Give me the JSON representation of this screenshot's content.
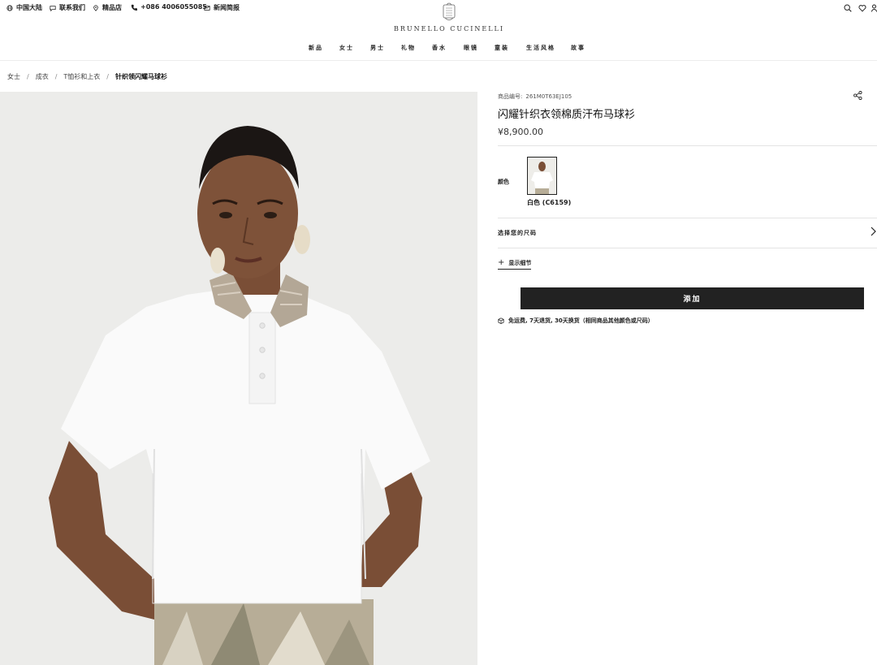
{
  "utility": {
    "items": [
      {
        "icon": "globe-icon",
        "label": "中国大陆"
      },
      {
        "icon": "chat-icon",
        "label": "联系我们"
      },
      {
        "icon": "location-pin-icon",
        "label": "精品店"
      },
      {
        "icon": "phone-icon",
        "label": "+086 4006055085"
      },
      {
        "icon": "mail-icon",
        "label": "新闻简报"
      }
    ],
    "right_icons": [
      "search-icon",
      "heart-icon",
      "user-icon"
    ]
  },
  "brand": {
    "name": "BRUNELLO CUCINELLI"
  },
  "nav": {
    "items": [
      "新品",
      "女士",
      "男士",
      "礼物",
      "香水",
      "眼镜",
      "童装",
      "生活风格",
      "故事"
    ]
  },
  "breadcrumb": {
    "items": [
      "女士",
      "成衣",
      "T恤衫和上衣"
    ],
    "current": "针织领闪耀马球衫",
    "separator": "/"
  },
  "product": {
    "sku_label": "商品编号:",
    "sku": "261M0T63EJ105",
    "title": "闪耀针织衣领棉质汗布马球衫",
    "price": "¥8,900.00",
    "color_label": "颜色",
    "color_name": "白色 (C6159)",
    "size_label": "选择您的尺码",
    "details_label": "显示细节",
    "add_label": "添加",
    "shipping_text": "免运费, 7天退货, 30天换货（相同商品其他颜色或尺码）"
  },
  "colors": {
    "button_bg": "#222222",
    "image_bg": "#ececea"
  }
}
